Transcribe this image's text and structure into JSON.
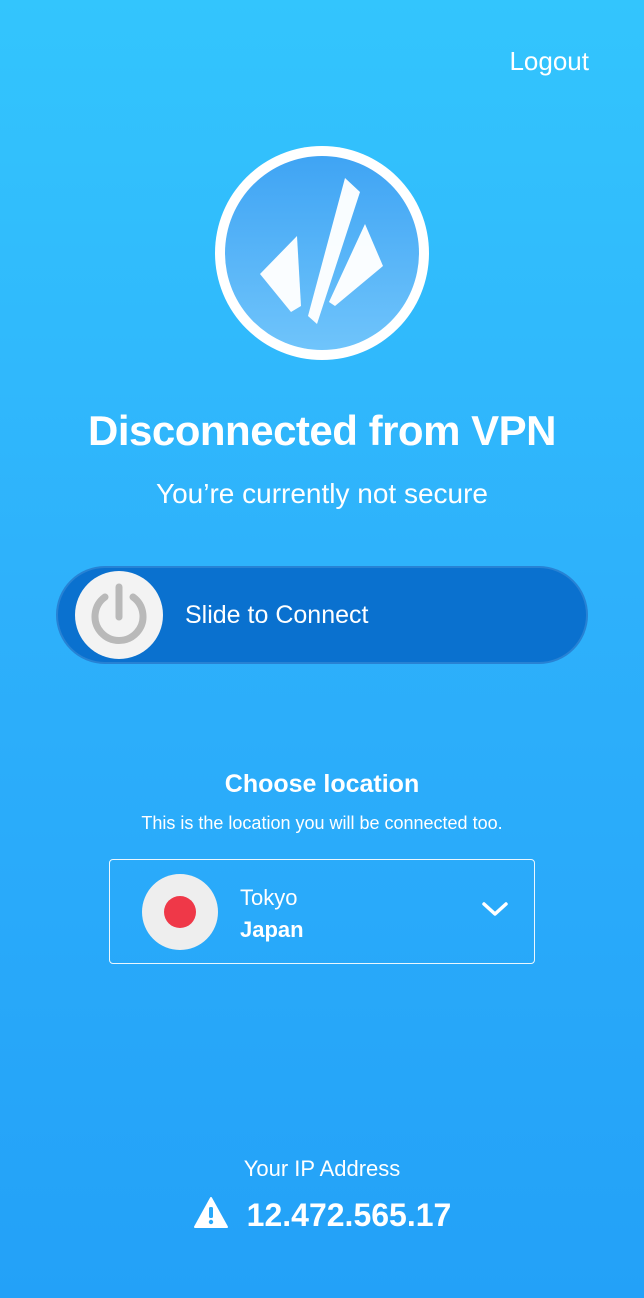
{
  "header": {
    "logout_label": "Logout"
  },
  "logo": {
    "icon": "vpn-app-logo-icon"
  },
  "status": {
    "title": "Disconnected from VPN",
    "subtitle": "You’re currently not secure"
  },
  "connect": {
    "slider_label": "Slide to Connect",
    "knob_icon": "power-icon"
  },
  "location": {
    "section_title": "Choose location",
    "section_subtitle": "This is the location you will be connected too.",
    "city": "Tokyo",
    "country": "Japan",
    "flag_icon": "japan-flag-icon",
    "dropdown_icon": "chevron-down-icon"
  },
  "ip": {
    "label": "Your IP Address",
    "value": "12.472.565.17",
    "warning_icon": "warning-icon"
  },
  "colors": {
    "background_top": "#33c5fd",
    "background_bottom": "#23a1f8",
    "slider_track": "#0a71cf",
    "flag_red": "#ef3848",
    "text": "#ffffff"
  }
}
